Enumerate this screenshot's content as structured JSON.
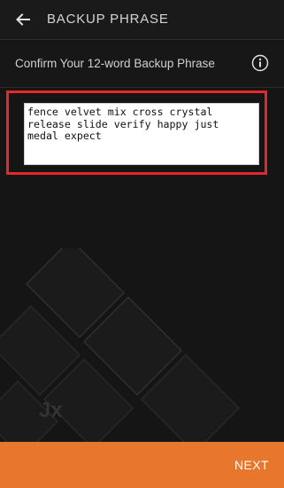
{
  "header": {
    "title": "BACKUP PHRASE",
    "back_icon": "arrow-left-icon"
  },
  "subheader": {
    "title": "Confirm Your 12-word Backup Phrase",
    "info_icon": "info-icon"
  },
  "phrase": {
    "value": "fence velvet mix cross crystal release slide verify happy just medal expect"
  },
  "background": {
    "logo_text": "Jx"
  },
  "footer": {
    "next_label": "NEXT"
  },
  "colors": {
    "background": "#151515",
    "accent": "#e8762c",
    "highlight": "#e5262a"
  }
}
